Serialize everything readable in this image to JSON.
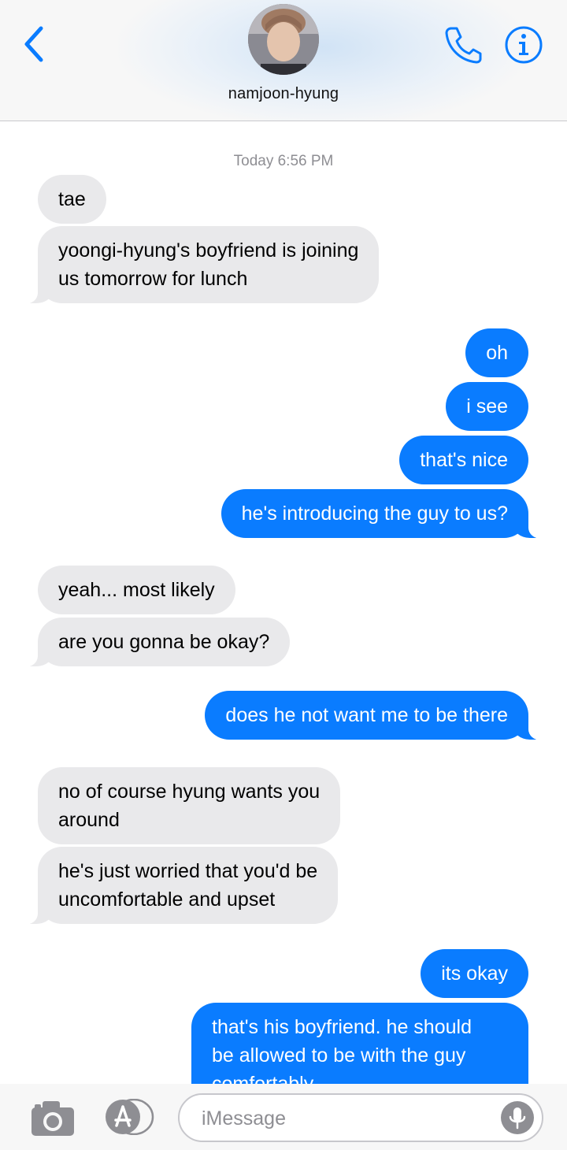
{
  "header": {
    "contact_name": "namjoon-hyung",
    "accent_color": "#0a7cff"
  },
  "thread": {
    "timestamp": "Today 6:56 PM",
    "messages": [
      {
        "sender": "contact",
        "text": "tae"
      },
      {
        "sender": "contact",
        "text": "yoongi-hyung's boyfriend is joining",
        "text2": "us tomorrow for lunch"
      },
      {
        "sender": "me",
        "text": "oh"
      },
      {
        "sender": "me",
        "text": "i see"
      },
      {
        "sender": "me",
        "text": "that's nice"
      },
      {
        "sender": "me",
        "text": "he's introducing the guy to us?"
      },
      {
        "sender": "contact",
        "text": "yeah... most likely"
      },
      {
        "sender": "contact",
        "text": "are you gonna be okay?"
      },
      {
        "sender": "me",
        "text": "does he not want me to be there"
      },
      {
        "sender": "contact",
        "text": "no of course hyung wants you",
        "text2": "around"
      },
      {
        "sender": "contact",
        "text": "he's just worried that you'd be",
        "text2": "uncomfortable and upset"
      },
      {
        "sender": "me",
        "text": "its okay"
      },
      {
        "sender": "me",
        "text": "that's his boyfriend. he should",
        "text2": "be allowed to be with the guy",
        "text3": "comfortably"
      }
    ]
  },
  "input_bar": {
    "placeholder": "iMessage"
  },
  "icons": [
    "back-chevron-icon",
    "avatar",
    "phone-icon",
    "info-icon",
    "camera-icon",
    "app-store-icon",
    "microphone-icon"
  ]
}
